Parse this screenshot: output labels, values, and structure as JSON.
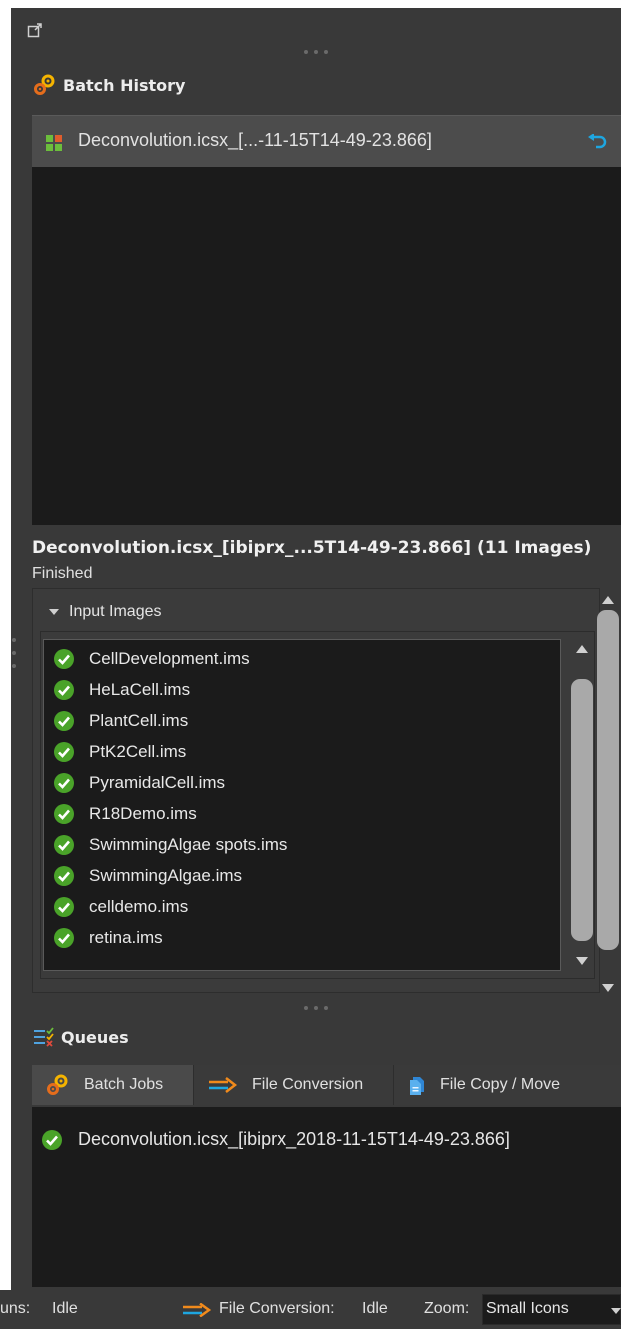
{
  "batch_history": {
    "title": "Batch History",
    "items": [
      {
        "label": "Deconvolution.icsx_[...-11-15T14-49-23.866]",
        "icon": "grid-icon"
      }
    ]
  },
  "details": {
    "title": "Deconvolution.icsx_[ibiprx_...5T14-49-23.866] (11 Images)",
    "status": "Finished",
    "input_images_label": "Input Images",
    "images": [
      "CellDevelopment.ims",
      "HeLaCell.ims",
      "PlantCell.ims",
      "PtK2Cell.ims",
      "PyramidalCell.ims",
      "R18Demo.ims",
      "SwimmingAlgae spots.ims",
      "SwimmingAlgae.ims",
      "celldemo.ims",
      "retina.ims"
    ]
  },
  "queues": {
    "title": "Queues",
    "tabs": [
      {
        "label": "Batch Jobs",
        "icon": "gears-icon",
        "active": true
      },
      {
        "label": "File Conversion",
        "icon": "arrow-icon",
        "active": false
      },
      {
        "label": "File Copy / Move",
        "icon": "file-icon",
        "active": false
      }
    ],
    "items": [
      {
        "label": "Deconvolution.icsx_[ibiprx_2018-11-15T14-49-23.866]",
        "status": "completed"
      }
    ]
  },
  "status_bar": {
    "runs_label": "uns:",
    "runs_value": "Idle",
    "conversion_label": "File Conversion:",
    "conversion_value": "Idle",
    "zoom_label": "Zoom:",
    "zoom_value": "Small Icons"
  },
  "colors": {
    "background": "#393939",
    "panel": "#1b1b1b",
    "selected": "#4c4c4c",
    "check_green": "#4aa329",
    "accent_orange": "#f08a1c",
    "accent_blue": "#1ea6e0"
  }
}
